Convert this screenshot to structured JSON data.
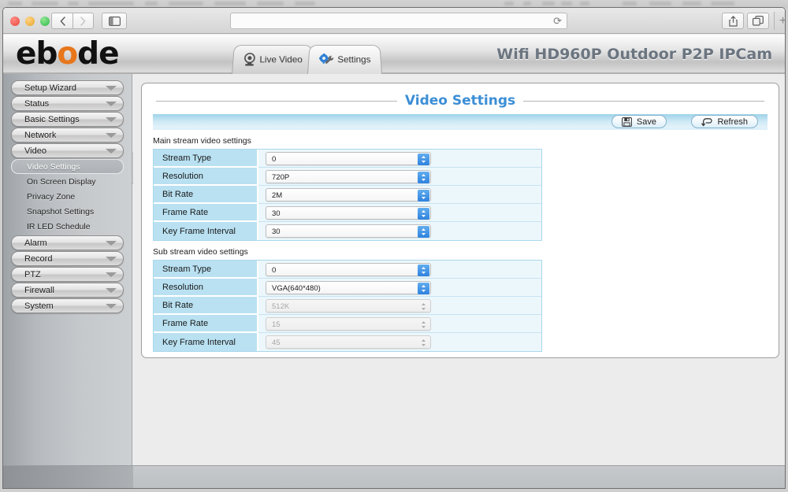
{
  "browser": {
    "window_controls": [
      "close",
      "minimize",
      "zoom"
    ],
    "back_label": "‹",
    "forward_label": "›",
    "sidebar_toggle_icon": "sidebar-icon",
    "address_value": "",
    "address_placeholder": "",
    "reload_icon": "⟳",
    "share_icon": "share-icon",
    "tabs_icon": "tabs-icon",
    "new_tab_label": "+"
  },
  "header": {
    "logo_part1": "eb",
    "logo_accent": "o",
    "logo_part2": "de",
    "product_title": "Wifi HD960P Outdoor P2P IPCam",
    "tabs": [
      {
        "label": "Live Video",
        "icon": "camera-icon",
        "active": false
      },
      {
        "label": "Settings",
        "icon": "gear-wrench-icon",
        "active": true
      }
    ]
  },
  "sidebar": {
    "items": [
      {
        "label": "Setup Wizard"
      },
      {
        "label": "Status"
      },
      {
        "label": "Basic Settings"
      },
      {
        "label": "Network"
      },
      {
        "label": "Video"
      },
      {
        "label": "Alarm"
      },
      {
        "label": "Record"
      },
      {
        "label": "PTZ"
      },
      {
        "label": "Firewall"
      },
      {
        "label": "System"
      }
    ],
    "video_submenu": [
      {
        "label": "Video Settings",
        "active": true
      },
      {
        "label": "On Screen Display",
        "active": false
      },
      {
        "label": "Privacy Zone",
        "active": false
      },
      {
        "label": "Snapshot Settings",
        "active": false
      },
      {
        "label": "IR LED Schedule",
        "active": false
      }
    ],
    "collapse_icon": "chevron-left-icon"
  },
  "main": {
    "page_title": "Video Settings",
    "save_label": "Save",
    "save_icon": "floppy-disk-icon",
    "refresh_label": "Refresh",
    "refresh_icon": "refresh-arrow-icon",
    "main_stream": {
      "section_label": "Main stream video settings",
      "rows": [
        {
          "label": "Stream Type",
          "value": "0",
          "disabled": false
        },
        {
          "label": "Resolution",
          "value": "720P",
          "disabled": false
        },
        {
          "label": "Bit Rate",
          "value": "2M",
          "disabled": false
        },
        {
          "label": "Frame Rate",
          "value": "30",
          "disabled": false
        },
        {
          "label": "Key Frame Interval",
          "value": "30",
          "disabled": false
        }
      ]
    },
    "sub_stream": {
      "section_label": "Sub stream video settings",
      "rows": [
        {
          "label": "Stream Type",
          "value": "0",
          "disabled": false
        },
        {
          "label": "Resolution",
          "value": "VGA(640*480)",
          "disabled": false
        },
        {
          "label": "Bit Rate",
          "value": "512K",
          "disabled": true
        },
        {
          "label": "Frame Rate",
          "value": "15",
          "disabled": true
        },
        {
          "label": "Key Frame Interval",
          "value": "45",
          "disabled": true
        }
      ]
    }
  },
  "colors": {
    "accent_blue": "#3b8ed6",
    "label_cell_blue": "#b9e1f2",
    "select_arrow_blue": "#2f82de",
    "logo_orange": "#e8761b",
    "product_title_grey": "#6b7580"
  }
}
